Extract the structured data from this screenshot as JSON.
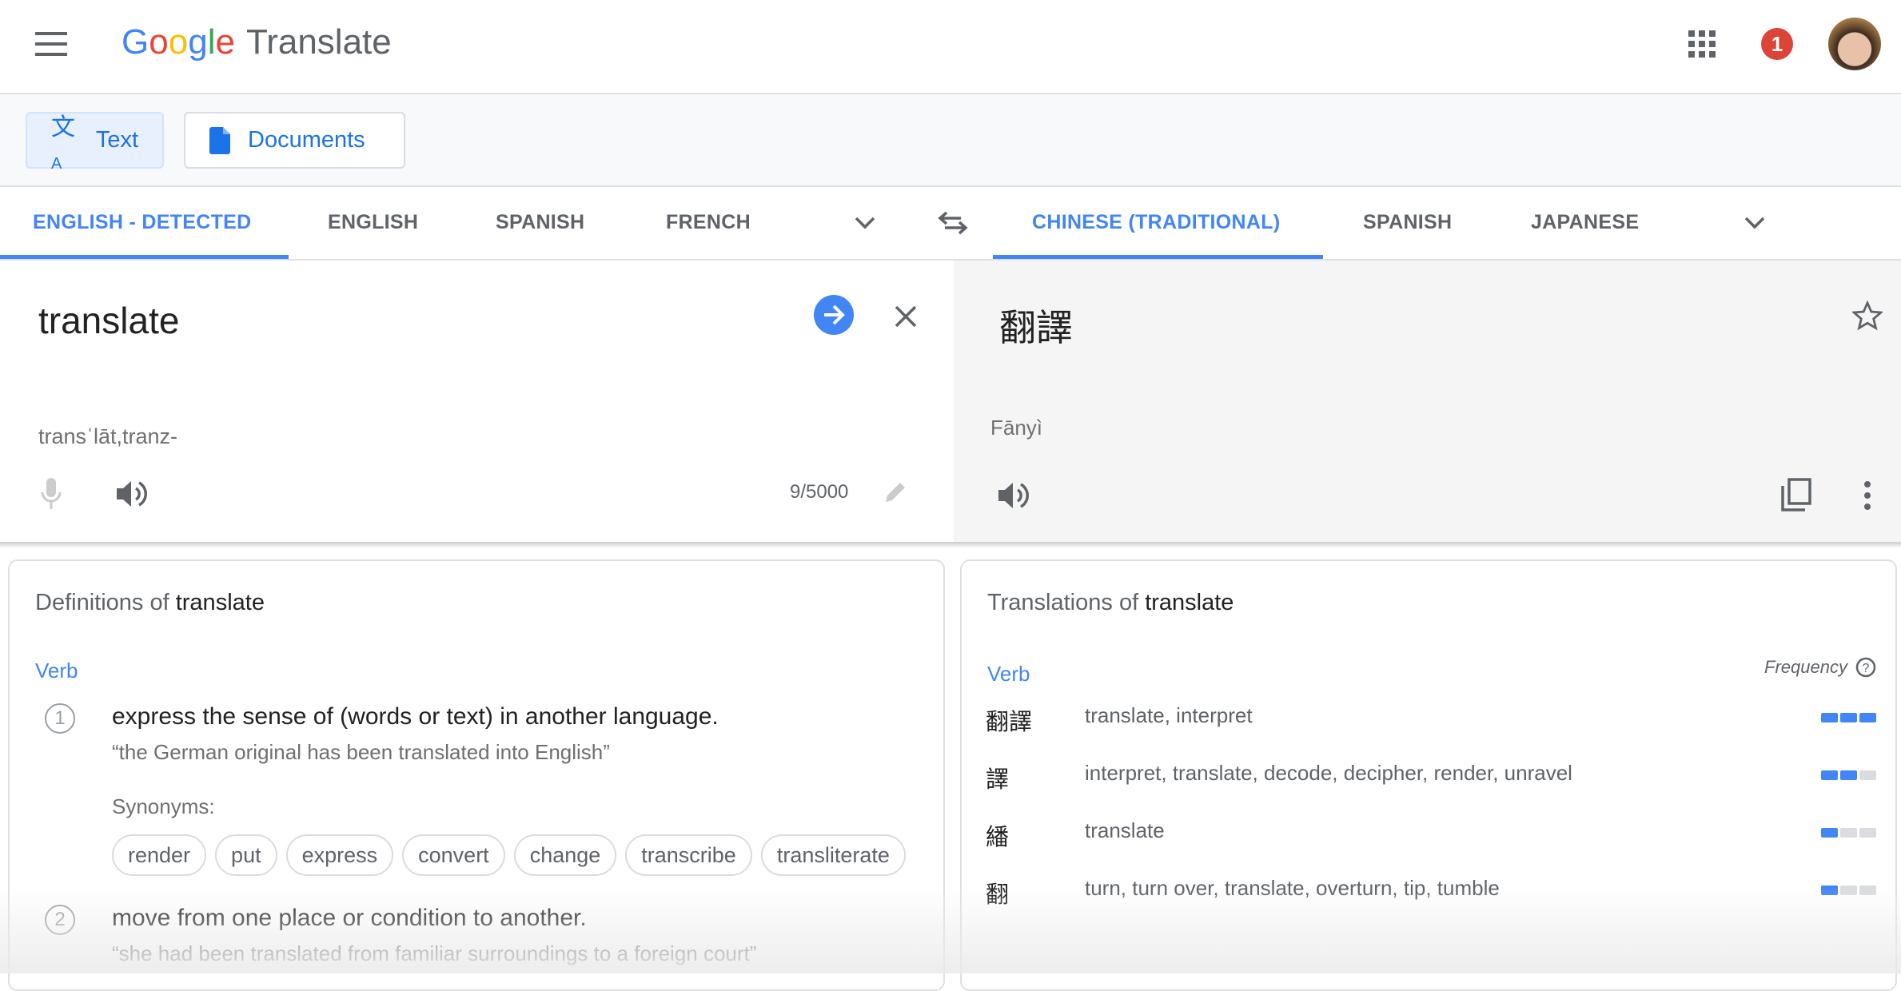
{
  "header": {
    "logo": "Google",
    "app_name": "Translate",
    "notification_count": "1"
  },
  "toolbar": {
    "text_label": "Text",
    "documents_label": "Documents"
  },
  "source_langs": [
    {
      "label": "ENGLISH - DETECTED",
      "active": true
    },
    {
      "label": "ENGLISH"
    },
    {
      "label": "SPANISH"
    },
    {
      "label": "FRENCH"
    }
  ],
  "target_langs": [
    {
      "label": "CHINESE (TRADITIONAL)",
      "active": true
    },
    {
      "label": "SPANISH"
    },
    {
      "label": "JAPANESE"
    }
  ],
  "source": {
    "text": "translate",
    "pronunciation": "transˈlāt,tranz-",
    "char_count": "9/5000"
  },
  "target": {
    "text": "翻譯",
    "romanization": "Fānyì"
  },
  "definitions": {
    "title_prefix": "Definitions of",
    "word": "translate",
    "pos": "Verb",
    "synonyms_label": "Synonyms:",
    "items": [
      {
        "num": "1",
        "text": "express the sense of (words or text) in another language.",
        "example": "“the German original has been translated into English”",
        "synonyms": [
          "render",
          "put",
          "express",
          "convert",
          "change",
          "transcribe",
          "transliterate"
        ]
      },
      {
        "num": "2",
        "text": "move from one place or condition to another.",
        "example": "“she had been translated from familiar surroundings to a foreign court”"
      }
    ]
  },
  "translations": {
    "title_prefix": "Translations of",
    "word": "translate",
    "pos": "Verb",
    "frequency_label": "Frequency",
    "rows": [
      {
        "term": "翻譯",
        "meanings": "translate, interpret",
        "frequency": 3
      },
      {
        "term": "譯",
        "meanings": "interpret, translate, decode, decipher, render, unravel",
        "frequency": 2
      },
      {
        "term": "繙",
        "meanings": "translate",
        "frequency": 1
      },
      {
        "term": "翻",
        "meanings": "turn, turn over, translate, overturn, tip, tumble",
        "frequency": 1
      }
    ]
  },
  "colors": {
    "accent": "#4285f4",
    "badge": "#db4437",
    "target_bg": "#f5f5f5"
  }
}
